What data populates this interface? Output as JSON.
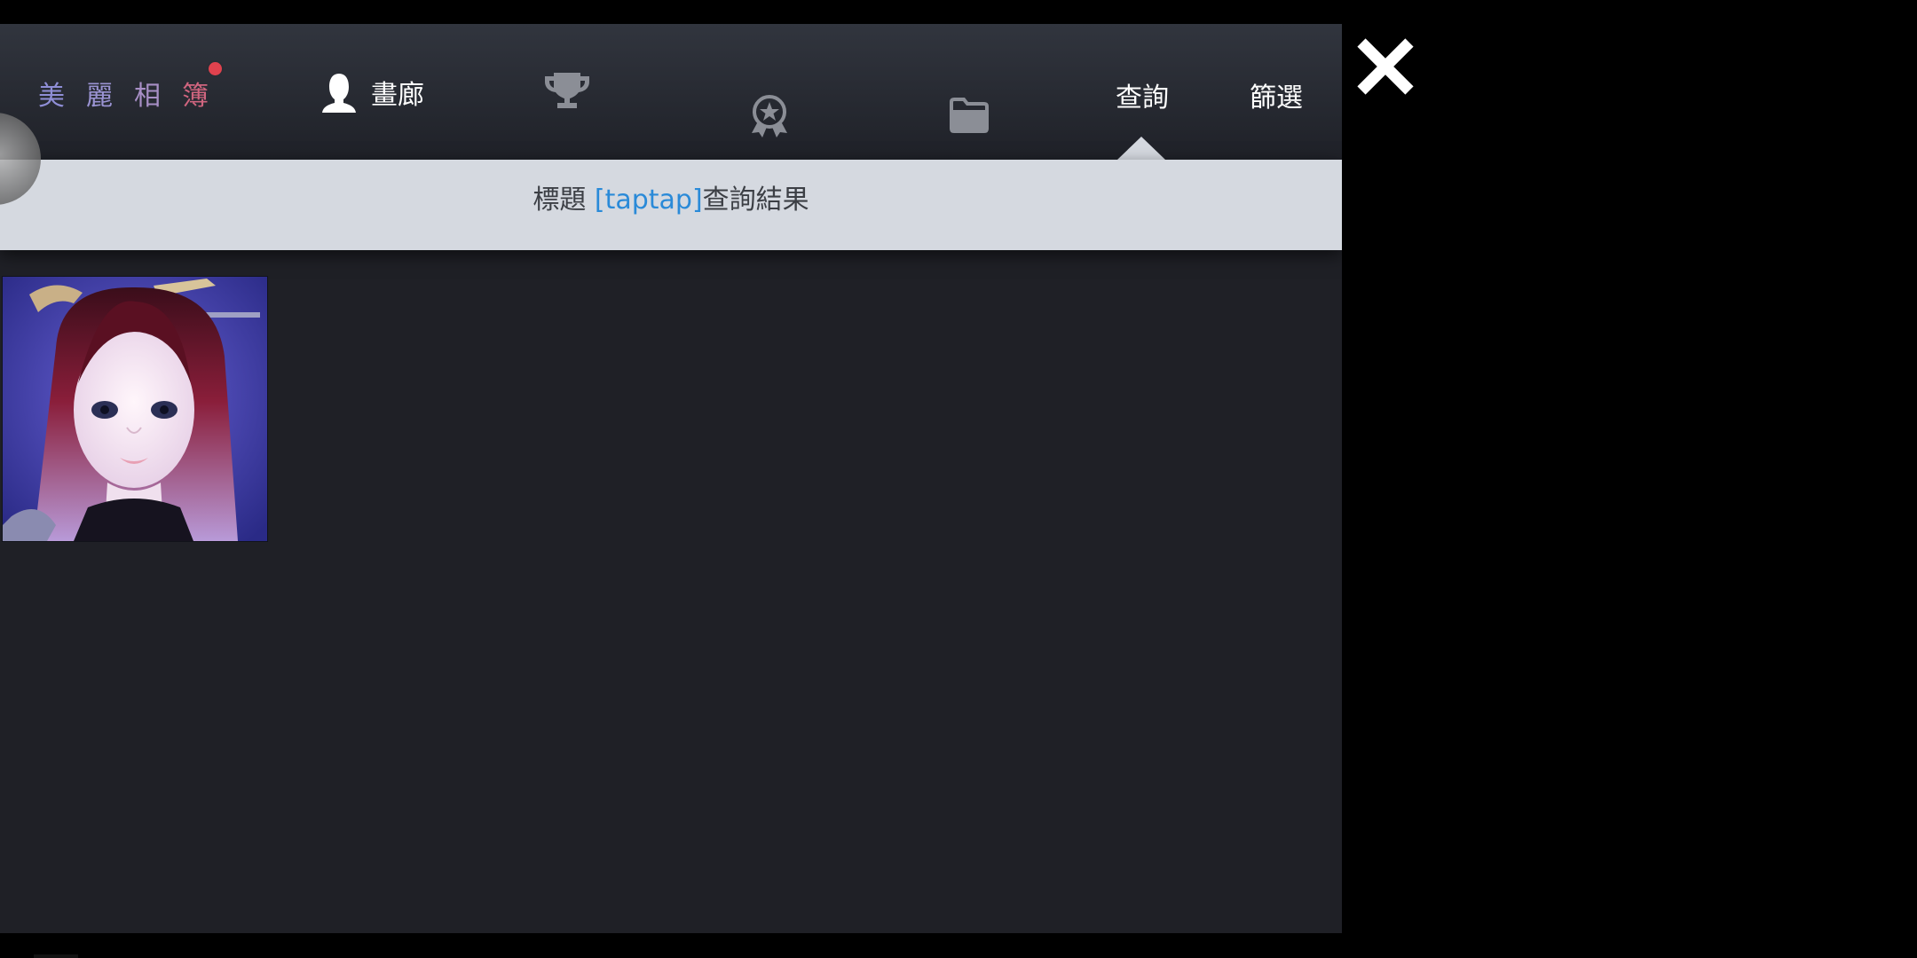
{
  "nav": {
    "brand": [
      "美",
      "麗",
      "相",
      "簿"
    ],
    "brand_colors": [
      "#8f8ed6",
      "#9a93d2",
      "#a88fc6",
      "#d0657f"
    ],
    "gallery_label": "畫廊",
    "trophy_icon": "trophy-icon",
    "badge_icon": "award-ribbon-icon",
    "folder_icon": "folder-icon",
    "query_label": "查詢",
    "filter_label": "篩選",
    "active_tab": "查詢"
  },
  "result": {
    "prefix": "標題 ",
    "query": "[taptap]",
    "suffix": "查詢結果"
  },
  "results": [
    {
      "thumb": "portrait-thumbnail"
    }
  ],
  "close_icon": "close-icon",
  "colors": {
    "panel": "#1f2026",
    "result_bar": "#d5d9e0",
    "accent": "#2a8ad8",
    "notification": "#e0424e"
  }
}
